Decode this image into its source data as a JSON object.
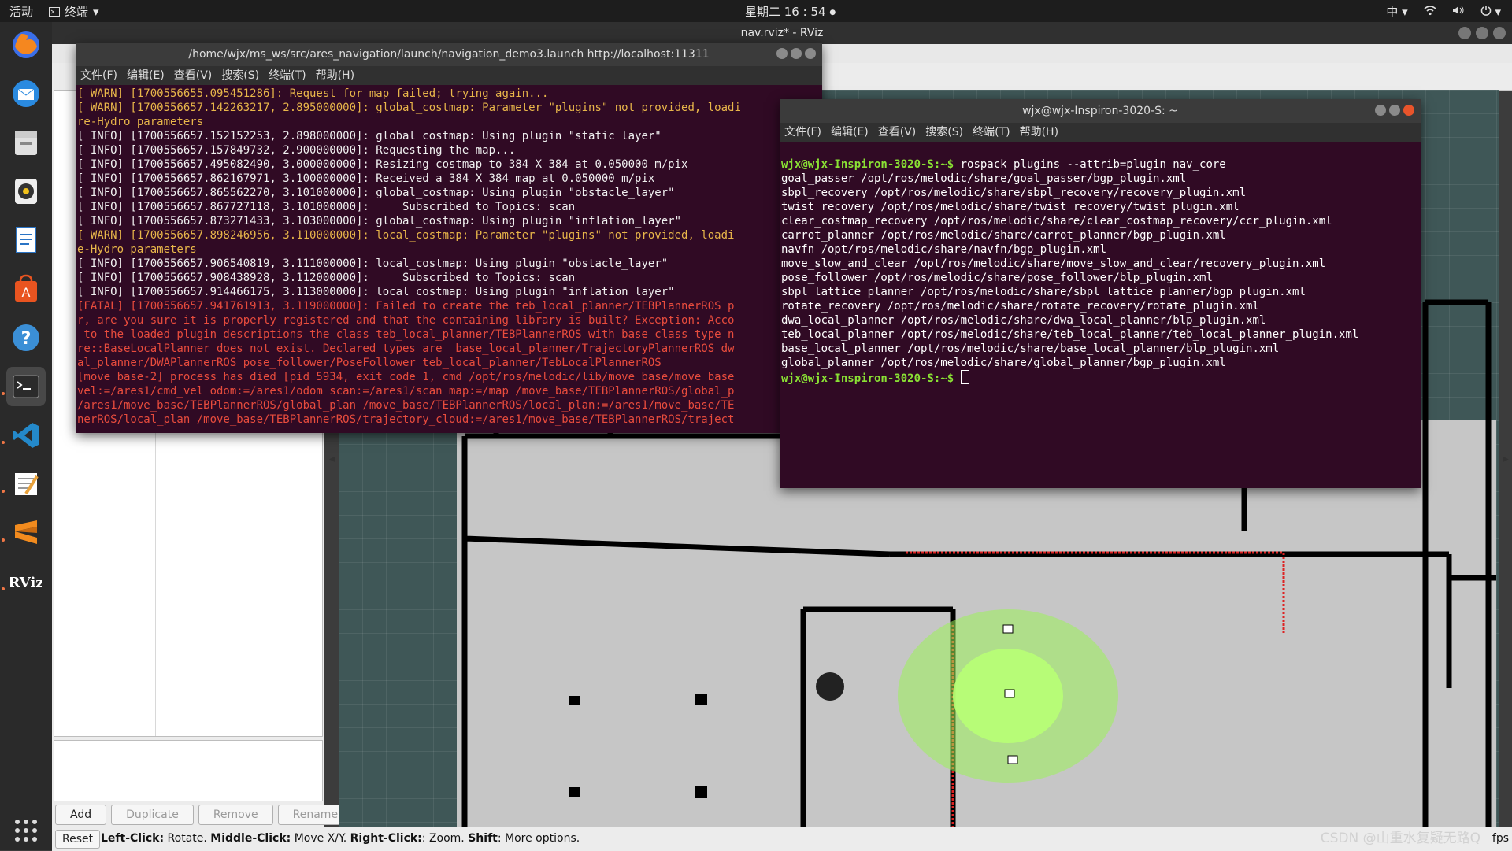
{
  "topbar": {
    "activities": "活动",
    "app_menu": "终端",
    "clock": "星期二 16 : 54",
    "input_method": "中"
  },
  "rviz": {
    "title": "nav.rviz* - RViz",
    "buttons": [
      "Add",
      "Duplicate",
      "Remove",
      "Rename"
    ],
    "reset": "Reset",
    "hint_left_click": "Left-Click:",
    "hint_left_click_action": " Rotate. ",
    "hint_middle_click": "Middle-Click:",
    "hint_middle_click_action": " Move X/Y. ",
    "hint_right_click": "Right-Click:",
    "hint_right_click_action": ": Zoom. ",
    "hint_shift": "Shift",
    "hint_shift_action": ": More options.",
    "fps": "fps"
  },
  "terminal1": {
    "title": "/home/wjx/ms_ws/src/ares_navigation/launch/navigation_demo3.launch http://localhost:11311",
    "menu": [
      "文件(F)",
      "编辑(E)",
      "查看(V)",
      "搜索(S)",
      "终端(T)",
      "帮助(H)"
    ],
    "lines": [
      {
        "level": "warn",
        "text": "[ WARN] [1700556655.095451286]: Request for map failed; trying again..."
      },
      {
        "level": "warn",
        "text": "[ WARN] [1700556657.142263217, 2.895000000]: global_costmap: Parameter \"plugins\" not provided, loadi"
      },
      {
        "level": "warn",
        "text": "re-Hydro parameters"
      },
      {
        "level": "info",
        "text": "[ INFO] [1700556657.152152253, 2.898000000]: global_costmap: Using plugin \"static_layer\""
      },
      {
        "level": "info",
        "text": "[ INFO] [1700556657.157849732, 2.900000000]: Requesting the map..."
      },
      {
        "level": "info",
        "text": "[ INFO] [1700556657.495082490, 3.000000000]: Resizing costmap to 384 X 384 at 0.050000 m/pix"
      },
      {
        "level": "info",
        "text": "[ INFO] [1700556657.862167971, 3.100000000]: Received a 384 X 384 map at 0.050000 m/pix"
      },
      {
        "level": "info",
        "text": "[ INFO] [1700556657.865562270, 3.101000000]: global_costmap: Using plugin \"obstacle_layer\""
      },
      {
        "level": "info",
        "text": "[ INFO] [1700556657.867727118, 3.101000000]:     Subscribed to Topics: scan"
      },
      {
        "level": "info",
        "text": "[ INFO] [1700556657.873271433, 3.103000000]: global_costmap: Using plugin \"inflation_layer\""
      },
      {
        "level": "warn",
        "text": "[ WARN] [1700556657.898246956, 3.110000000]: local_costmap: Parameter \"plugins\" not provided, loadi"
      },
      {
        "level": "warn",
        "text": "e-Hydro parameters"
      },
      {
        "level": "info",
        "text": "[ INFO] [1700556657.906540819, 3.111000000]: local_costmap: Using plugin \"obstacle_layer\""
      },
      {
        "level": "info",
        "text": "[ INFO] [1700556657.908438928, 3.112000000]:     Subscribed to Topics: scan"
      },
      {
        "level": "info",
        "text": "[ INFO] [1700556657.914466175, 3.113000000]: local_costmap: Using plugin \"inflation_layer\""
      },
      {
        "level": "fatal",
        "text": "[FATAL] [1700556657.941761913, 3.119000000]: Failed to create the teb_local_planner/TEBPlannerROS p"
      },
      {
        "level": "fatal",
        "text": "r, are you sure it is properly registered and that the containing library is built? Exception: Acco"
      },
      {
        "level": "fatal",
        "text": " to the loaded plugin descriptions the class teb_local_planner/TEBPlannerROS with base class type n"
      },
      {
        "level": "fatal",
        "text": "re::BaseLocalPlanner does not exist. Declared types are  base_local_planner/TrajectoryPlannerROS dw"
      },
      {
        "level": "fatal",
        "text": "al_planner/DWAPlannerROS pose_follower/PoseFollower teb_local_planner/TebLocalPlannerROS"
      },
      {
        "level": "fatal",
        "text": "[move_base-2] process has died [pid 5934, exit code 1, cmd /opt/ros/melodic/lib/move_base/move_base"
      },
      {
        "level": "fatal",
        "text": "vel:=/ares1/cmd_vel odom:=/ares1/odom scan:=/ares1/scan map:=/map /move_base/TEBPlannerROS/global_p"
      },
      {
        "level": "fatal",
        "text": "/ares1/move_base/TEBPlannerROS/global_plan /move_base/TEBPlannerROS/local_plan:=/ares1/move_base/TE"
      },
      {
        "level": "fatal",
        "text": "nerROS/local_plan /move_base/TEBPlannerROS/trajectory_cloud:=/ares1/move_base/TEBPlannerROS/traject"
      }
    ]
  },
  "terminal2": {
    "title": "wjx@wjx-Inspiron-3020-S: ~",
    "menu": [
      "文件(F)",
      "编辑(E)",
      "查看(V)",
      "搜索(S)",
      "终端(T)",
      "帮助(H)"
    ],
    "prompt": "wjx@wjx-Inspiron-3020-S:~$",
    "command": " rospack plugins --attrib=plugin nav_core",
    "output": [
      "goal_passer /opt/ros/melodic/share/goal_passer/bgp_plugin.xml",
      "sbpl_recovery /opt/ros/melodic/share/sbpl_recovery/recovery_plugin.xml",
      "twist_recovery /opt/ros/melodic/share/twist_recovery/twist_plugin.xml",
      "clear_costmap_recovery /opt/ros/melodic/share/clear_costmap_recovery/ccr_plugin.xml",
      "carrot_planner /opt/ros/melodic/share/carrot_planner/bgp_plugin.xml",
      "navfn /opt/ros/melodic/share/navfn/bgp_plugin.xml",
      "move_slow_and_clear /opt/ros/melodic/share/move_slow_and_clear/recovery_plugin.xml",
      "pose_follower /opt/ros/melodic/share/pose_follower/blp_plugin.xml",
      "sbpl_lattice_planner /opt/ros/melodic/share/sbpl_lattice_planner/bgp_plugin.xml",
      "rotate_recovery /opt/ros/melodic/share/rotate_recovery/rotate_plugin.xml",
      "dwa_local_planner /opt/ros/melodic/share/dwa_local_planner/blp_plugin.xml",
      "teb_local_planner /opt/ros/melodic/share/teb_local_planner/teb_local_planner_plugin.xml",
      "base_local_planner /opt/ros/melodic/share/base_local_planner/blp_plugin.xml",
      "global_planner /opt/ros/melodic/share/global_planner/bgp_plugin.xml"
    ],
    "final_prompt": "wjx@wjx-Inspiron-3020-S:~$"
  },
  "watermark": "CSDN @山重水复疑无路Q",
  "colors": {
    "terminal_bg": "#300a24",
    "warn": "#e8b64a",
    "fatal": "#e84c3d",
    "prompt": "#8ae234",
    "viewport_bg": "#3f5757",
    "map_free": "#c8c8c8",
    "particles": "#9cf35a"
  },
  "dock_icons": [
    "firefox-icon",
    "thunderbird-icon",
    "files-icon",
    "rhythmbox-icon",
    "libreoffice-writer-icon",
    "software-center-icon",
    "help-icon",
    "terminal-icon",
    "vscode-icon",
    "text-editor-icon",
    "sublime-icon",
    "rviz-icon",
    "show-apps-icon"
  ]
}
